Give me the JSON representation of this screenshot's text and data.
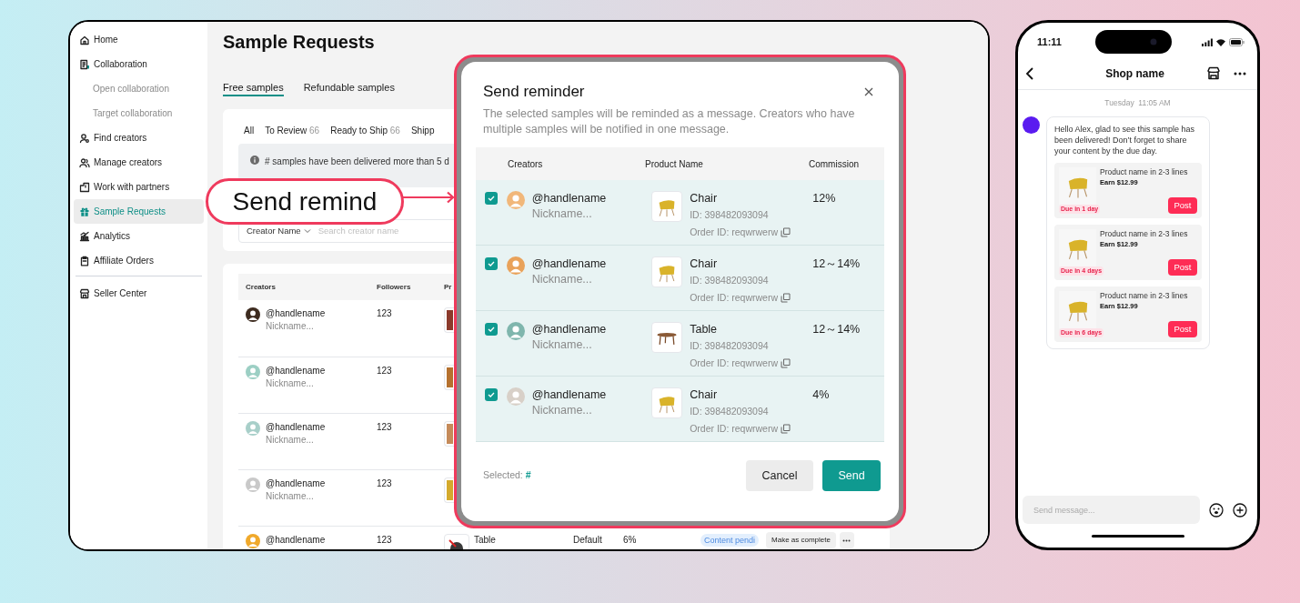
{
  "desktop": {
    "sidebar": {
      "sections": [
        {
          "items": [
            {
              "label": "Home",
              "selected": false
            },
            {
              "label": "Collaboration",
              "selected": false,
              "children": [
                {
                  "label": "Open collaboration",
                  "selected": false
                },
                {
                  "label": "Target collaboration",
                  "selected": false
                }
              ]
            },
            {
              "label": "Find creators",
              "selected": false
            },
            {
              "label": "Manage creators",
              "selected": false
            },
            {
              "label": "Work with partners",
              "selected": false
            },
            {
              "label": "Sample Requests",
              "selected": true
            },
            {
              "label": "Analytics",
              "selected": false
            },
            {
              "label": "Affiliate Orders",
              "selected": false
            }
          ]
        },
        {
          "items": [
            {
              "label": "Seller Center",
              "selected": false
            }
          ]
        }
      ]
    },
    "page_title": "Sample Requests",
    "tabs": [
      {
        "label": "Free samples",
        "selected": true
      },
      {
        "label": "Refundable samples",
        "selected": false
      }
    ],
    "status_tabs": [
      {
        "label": "All"
      },
      {
        "label": "To Review",
        "count": "66"
      },
      {
        "label": "Ready to Ship",
        "count": "66"
      },
      {
        "label": "Shipp"
      }
    ],
    "alert": "# samples have been delivered more than 5 d",
    "search": {
      "filter": "Creator Name",
      "placeholder": "Search creator name"
    },
    "table": {
      "columns": [
        "Creators",
        "Followers",
        "Pr"
      ],
      "rows": [
        {
          "handle": "@handlename",
          "nickname": "Nickname...",
          "followers": "123"
        },
        {
          "handle": "@handlename",
          "nickname": "Nickname...",
          "followers": "123"
        },
        {
          "handle": "@handlename",
          "nickname": "Nickname...",
          "followers": "123"
        },
        {
          "handle": "@handlename",
          "nickname": "Nickname...",
          "followers": "123"
        },
        {
          "handle": "@handlename",
          "followers": "123",
          "product": "Table",
          "variation": "Default",
          "commission": "6%",
          "status": "Content pendi",
          "action": "Make as complete"
        }
      ]
    }
  },
  "callout": {
    "label": "Send remind"
  },
  "modal": {
    "title": "Send reminder",
    "description": "The selected samples will be reminded as a message. Creators who have multiple samples will be notified in one message.",
    "columns": [
      "Creators",
      "Product Name",
      "Commission"
    ],
    "rows": [
      {
        "checked": true,
        "handle": "@handlename",
        "nickname": "Nickname...",
        "kind": "chair",
        "product": "Chair",
        "product_id": "ID: 398482093094",
        "order_id": "Order ID: reqwrwerw",
        "commission": "12%"
      },
      {
        "checked": true,
        "handle": "@handlename",
        "nickname": "Nickname...",
        "kind": "chair",
        "product": "Chair",
        "product_id": "ID: 398482093094",
        "order_id": "Order ID: reqwrwerw",
        "commission": "12～14%"
      },
      {
        "checked": true,
        "handle": "@handlename",
        "nickname": "Nickname...",
        "kind": "table",
        "product": "Table",
        "product_id": "ID: 398482093094",
        "order_id": "Order ID: reqwrwerw",
        "commission": "12～14%"
      },
      {
        "checked": true,
        "handle": "@handlename",
        "nickname": "Nickname...",
        "kind": "chair",
        "product": "Chair",
        "product_id": "ID: 398482093094",
        "order_id": "Order ID: reqwrwerw",
        "commission": "4%"
      }
    ],
    "selected_label": "Selected:",
    "selected_count": "#",
    "cancel": "Cancel",
    "send": "Send"
  },
  "phone": {
    "time": "11:11",
    "title": "Shop name",
    "timestamp": "Tuesday  11:05 AM",
    "message": "Hello Alex, glad to see this sample has been delivered! Don’t forget to share your content by the due day.",
    "cards": [
      {
        "name": "Product name in 2-3 lines",
        "earn": "Earn $12.99",
        "due": "Due in 1 day",
        "button": "Post"
      },
      {
        "name": "Product name in 2-3 lines",
        "earn": "Earn $12.99",
        "due": "Due in 4 days",
        "button": "Post"
      },
      {
        "name": "Product name in 2-3 lines",
        "earn": "Earn $12.99",
        "due": "Due in 6 days",
        "button": "Post"
      }
    ],
    "input": {
      "placeholder": "Send message..."
    }
  }
}
